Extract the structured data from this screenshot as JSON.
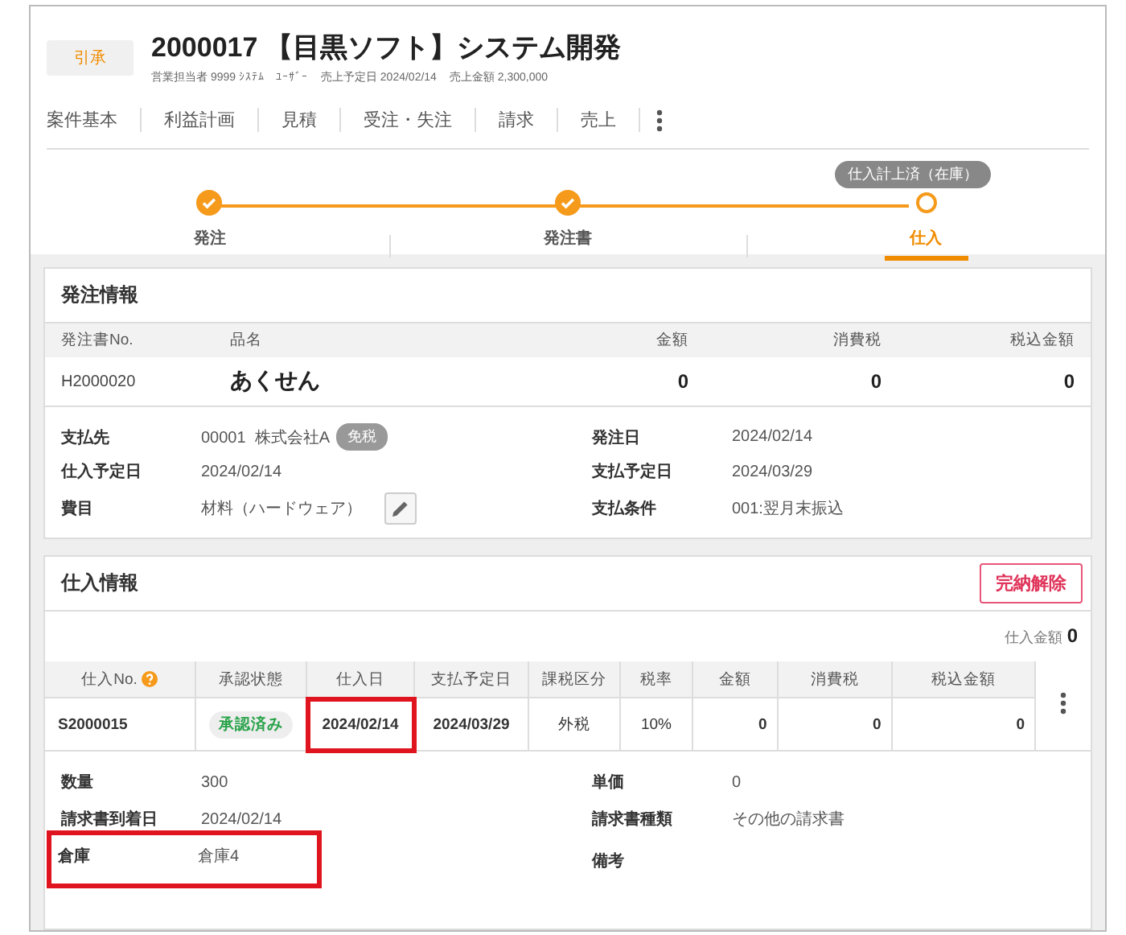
{
  "header": {
    "status_badge": "引承",
    "title": "2000017 【目黒ソフト】システム開発",
    "meta": [
      {
        "label": "営業担当者",
        "value": "9999 ｼｽﾃﾑ　ﾕｰｻﾞｰ"
      },
      {
        "label": "売上予定日",
        "value": "2024/02/14"
      },
      {
        "label": "売上金額",
        "value": "2,300,000"
      }
    ]
  },
  "tabs": [
    {
      "label": "案件基本",
      "selected": false
    },
    {
      "label": "利益計画",
      "selected": false
    },
    {
      "label": "見積",
      "selected": false
    },
    {
      "label": "受注・失注",
      "selected": false
    },
    {
      "label": "請求",
      "selected": false
    },
    {
      "label": "売上",
      "selected": false
    }
  ],
  "steps": {
    "status_pill": "仕入計上済（在庫）",
    "items": [
      {
        "label": "発注",
        "done": true,
        "selected": false
      },
      {
        "label": "発注書",
        "done": true,
        "selected": false
      },
      {
        "label": "仕入",
        "done": false,
        "selected": true
      }
    ]
  },
  "order_info": {
    "title": "発注情報",
    "columns": [
      {
        "label": "発注書No.",
        "kind": "text"
      },
      {
        "label": "品名",
        "kind": "name"
      },
      {
        "label": "金額",
        "kind": "amount"
      },
      {
        "label": "消費税",
        "kind": "amount"
      },
      {
        "label": "税込金額",
        "kind": "amount"
      }
    ],
    "row": [
      "H2000020",
      "あくせん",
      "0",
      "0",
      "0"
    ],
    "fields": [
      {
        "label": "支払先",
        "value": "00001  株式会社A",
        "badge": "免税"
      },
      {
        "label": "発注日",
        "value": "2024/02/14"
      },
      {
        "label": "仕入予定日",
        "value": "2024/02/14"
      },
      {
        "label": "支払予定日",
        "value": "2024/03/29"
      },
      {
        "label": "費目",
        "value": "材料（ハードウェア）",
        "editable": true
      },
      {
        "label": "支払条件",
        "value": "001:翌月末振込"
      }
    ]
  },
  "purchase_info": {
    "title": "仕入情報",
    "button": "完納解除",
    "total_label": "仕入金額",
    "total_value": "0",
    "columns": [
      {
        "label": "仕入No.",
        "help": true
      },
      {
        "label": "承認状態",
        "help": false
      },
      {
        "label": "仕入日",
        "help": false
      },
      {
        "label": "支払予定日",
        "help": false
      },
      {
        "label": "課税区分",
        "help": false
      },
      {
        "label": "税率",
        "help": false
      },
      {
        "label": "金額",
        "help": false
      },
      {
        "label": "消費税",
        "help": false
      },
      {
        "label": "税込金額",
        "help": false
      }
    ],
    "rows": [
      {
        "cells": [
          {
            "text": "S2000015",
            "kind": "id",
            "highlighted": false
          },
          {
            "text": "承認済み",
            "kind": "status",
            "highlighted": false
          },
          {
            "text": "2024/02/14",
            "kind": "date",
            "highlighted": true
          },
          {
            "text": "2024/03/29",
            "kind": "date",
            "highlighted": false
          },
          {
            "text": "外税",
            "kind": "plain",
            "highlighted": false
          },
          {
            "text": "10%",
            "kind": "plain",
            "highlighted": false
          },
          {
            "text": "0",
            "kind": "amount",
            "highlighted": false
          },
          {
            "text": "0",
            "kind": "amount",
            "highlighted": false
          },
          {
            "text": "0",
            "kind": "amount",
            "highlighted": false
          }
        ]
      }
    ],
    "fields": [
      {
        "label": "数量",
        "value": "300",
        "highlighted": false
      },
      {
        "label": "単価",
        "value": "0",
        "highlighted": false
      },
      {
        "label": "請求書到着日",
        "value": "2024/02/14",
        "highlighted": false
      },
      {
        "label": "請求書種類",
        "value": "その他の請求書",
        "highlighted": false
      },
      {
        "label": "倉庫",
        "value": "倉庫4",
        "highlighted": true
      },
      {
        "label": "備考",
        "highlighted": false
      }
    ]
  }
}
